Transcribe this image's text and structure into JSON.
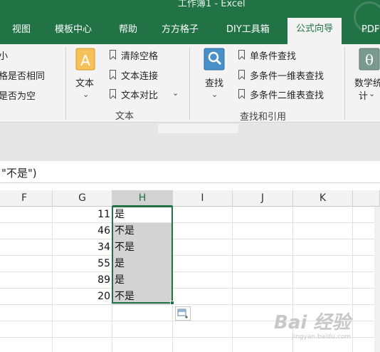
{
  "window_title": "工作簿1  -  Excel",
  "tabs": [
    {
      "label": "视图",
      "active": false
    },
    {
      "label": "模板中心",
      "active": false
    },
    {
      "label": "帮助",
      "active": false
    },
    {
      "label": "方方格子",
      "active": false
    },
    {
      "label": "DIY工具箱",
      "active": false
    },
    {
      "label": "公式向导",
      "active": true
    },
    {
      "label": "PDF",
      "active": false
    }
  ],
  "ribbon": {
    "left_partial_items": [
      "小",
      "格是否相同",
      "是否为空"
    ],
    "text_group": {
      "big_button_label": "文本",
      "items": [
        "清除空格",
        "文本连接",
        "文本对比"
      ],
      "group_label": "文本"
    },
    "lookup_group": {
      "big_button_label": "查找",
      "items": [
        "单条件查找",
        "多条件一维表查找",
        "多条件二维表查找"
      ],
      "group_label": "查找和引用"
    },
    "math_group": {
      "big_button_label_1": "数学统",
      "big_button_label_2": "计"
    },
    "big_icon_glyph_text": "A",
    "big_icon_glyph_math": "θ"
  },
  "formula_bar": {
    "visible_text": "\"不是\")"
  },
  "grid": {
    "columns": [
      "F",
      "G",
      "H",
      "I",
      "J",
      "K"
    ],
    "selected_column": "H",
    "rows": [
      {
        "g": "11",
        "h": "是"
      },
      {
        "g": "46",
        "h": "不是"
      },
      {
        "g": "34",
        "h": "不是"
      },
      {
        "g": "55",
        "h": "是"
      },
      {
        "g": "89",
        "h": "是"
      },
      {
        "g": "20",
        "h": "不是"
      }
    ]
  },
  "watermark": {
    "text": "Bai 经验",
    "sub": "jingyan.baidu.com"
  },
  "colors": {
    "excel_green": "#217346",
    "ribbon_bg": "#f3f3f3",
    "selection_shade": "#d3d3d3"
  },
  "icons": [
    "bookmark-icon",
    "text-a-icon",
    "search-icon",
    "theta-icon",
    "chevron-down-icon",
    "quick-analysis-icon"
  ]
}
